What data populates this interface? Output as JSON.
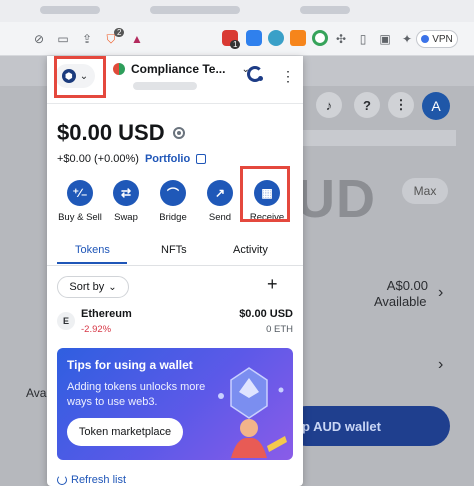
{
  "browser": {
    "vpn_label": "VPN",
    "brave_badge": "2",
    "ext_badge": "1"
  },
  "background_page": {
    "avatar_letter": "A",
    "big_text": "UD",
    "max_label": "Max",
    "amount": "A$0.00",
    "available": "Available",
    "available_partial": "Ava",
    "button_label": "p AUD wallet"
  },
  "wallet": {
    "account_name": "Compliance Te...",
    "balance": "$0.00 USD",
    "change": "+$0.00 (+0.00%)",
    "portfolio_label": "Portfolio",
    "actions": [
      {
        "label": "Buy & Sell",
        "icon": "buy-sell-icon",
        "glyph": "⁺∕₋"
      },
      {
        "label": "Swap",
        "icon": "swap-icon",
        "glyph": "⇄"
      },
      {
        "label": "Bridge",
        "icon": "bridge-icon",
        "glyph": "⌒"
      },
      {
        "label": "Send",
        "icon": "send-icon",
        "glyph": "↗"
      },
      {
        "label": "Receive",
        "icon": "receive-icon",
        "glyph": "▦"
      }
    ],
    "tabs": [
      "Tokens",
      "NFTs",
      "Activity"
    ],
    "active_tab": "Tokens",
    "sort_label": "Sort by",
    "token": {
      "name": "Ethereum",
      "change": "-2.92%",
      "usd": "$0.00 USD",
      "balance": "0 ETH"
    },
    "tips": {
      "title": "Tips for using a wallet",
      "body": "Adding tokens unlocks more ways to use web3.",
      "button": "Token marketplace"
    },
    "refresh_label": "Refresh list"
  },
  "colors": {
    "accent": "#1f56b8",
    "highlight": "#e4483d",
    "negative": "#d73847"
  }
}
